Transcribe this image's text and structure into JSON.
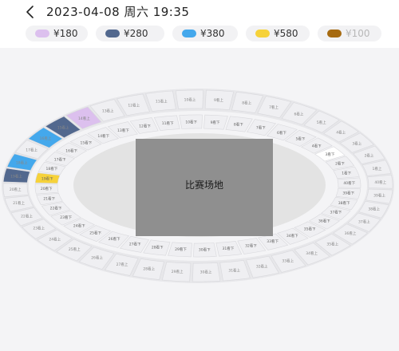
{
  "header": {
    "title": "2023-04-08 周六 19:35",
    "back_icon": "chevron-left-icon"
  },
  "prices": [
    {
      "label": "¥180",
      "color": "#dcc0ee",
      "disabled": false
    },
    {
      "label": "¥280",
      "color": "#52688e",
      "disabled": false
    },
    {
      "label": "¥380",
      "color": "#44a8ec",
      "disabled": false
    },
    {
      "label": "¥580",
      "color": "#f6d23a",
      "disabled": false
    },
    {
      "label": "¥100",
      "color": "#a66a10",
      "disabled": true
    }
  ],
  "stadium": {
    "field_label": "比赛场地",
    "colors": {
      "field": "#8f8f8f",
      "plaza": "#e3e3e3",
      "inner_ring": "#f4f4f6",
      "outer_ring": "#e7e7ea",
      "seat": "#efeff2",
      "seat_stroke": "#d8d8dc",
      "sold_out": "#ffffff"
    },
    "labels_upper": [
      "11看上",
      "10看上",
      "9看上",
      "8看上",
      "7看上",
      "6看上",
      "5看上",
      "4看上",
      "3看上",
      "2看上",
      "1看上",
      "40看上",
      "39看上",
      "38看上",
      "37看上",
      "36看上",
      "35看上",
      "34看上",
      "33看上",
      "32看上",
      "31看上",
      "30看上",
      "29看上",
      "28看上",
      "27看上",
      "26看上",
      "25看上",
      "24看上",
      "23看上",
      "22看上",
      "21看上",
      "20看上",
      "19看上",
      "18看上",
      "17看上",
      "16看上",
      "15看上",
      "14看上",
      "13看上",
      "12看上"
    ],
    "labels_lower": [
      "11看下",
      "10看下",
      "9看下",
      "8看下",
      "7看下",
      "6看下",
      "5看下",
      "4看下",
      "3看下",
      "2看下",
      "1看下",
      "40看下",
      "39看下",
      "38看下",
      "37看下",
      "36看下",
      "35看下",
      "34看下",
      "33看下",
      "32看下",
      "31看下",
      "30看下",
      "29看下",
      "28看下",
      "27看下",
      "26看下",
      "25看下",
      "24看下",
      "23看下",
      "22看下",
      "21看下",
      "20看下",
      "19看下",
      "18看下",
      "17看下",
      "16看下",
      "15看下",
      "14看下",
      "13看下",
      "12看下"
    ],
    "upper_prices": {
      "14看上": 0,
      "15看上": 1,
      "16看上": 2,
      "18看上": 2,
      "19看上": 1
    },
    "lower_prices": {
      "19看下": 3
    },
    "sold_out": [
      "3看下"
    ]
  }
}
